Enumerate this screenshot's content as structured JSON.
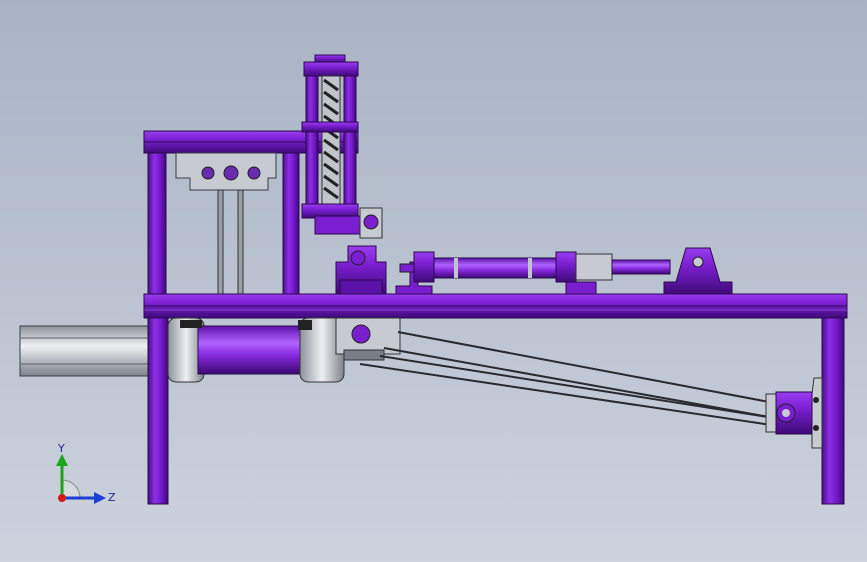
{
  "viewport": {
    "background_top": "#a9b3c4",
    "background_bottom": "#cdd3dd"
  },
  "colors": {
    "frame_purple": "#7a1fd0",
    "frame_purple_dark": "#4a0d8c",
    "frame_edge": "#2b0a4d",
    "steel_gray": "#c9cdd4",
    "dark_gray": "#55585e",
    "belt": "#2a2a2e"
  },
  "triad": {
    "y_label": "Y",
    "z_label": "Z",
    "y_color": "#1aa51a",
    "z_color": "#1d3fd6",
    "x_color": "#d41b1b"
  }
}
